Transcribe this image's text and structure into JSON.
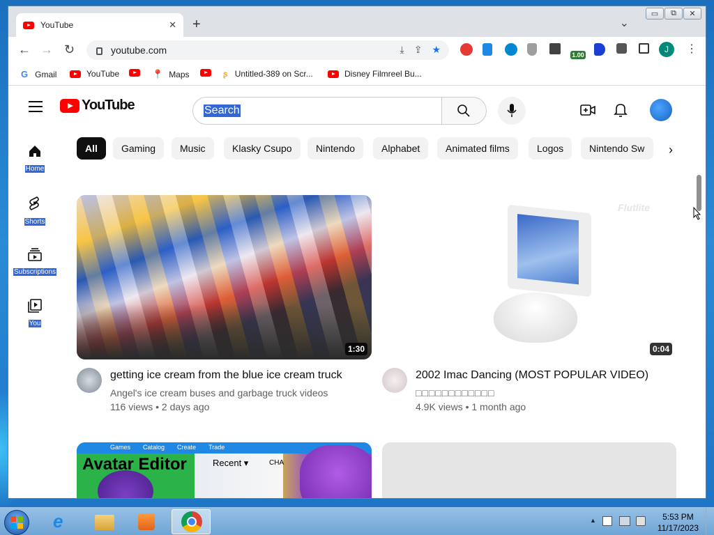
{
  "browser": {
    "tab": {
      "title": "YouTube",
      "close": "✕"
    },
    "new_tab": "+",
    "tab_search": "⌄",
    "window_controls": {
      "minimize": "▭",
      "restore": "⧉",
      "close": "✕"
    },
    "nav": {
      "back": "←",
      "forward": "→",
      "reload": "↻"
    },
    "url": "youtube.com",
    "profile_initial": "J",
    "extension_badge": "1.00",
    "menu": "⋮"
  },
  "bookmarks": [
    {
      "label": "Gmail",
      "icon": "google-icon"
    },
    {
      "label": "YouTube",
      "icon": "youtube-icon"
    },
    {
      "label": "",
      "icon": "youtube-icon"
    },
    {
      "label": "Maps",
      "icon": "maps-pin-icon"
    },
    {
      "label": "",
      "icon": "youtube-icon"
    },
    {
      "label": "Untitled-389 on Scr...",
      "icon": "scratch-icon"
    },
    {
      "label": "Disney Filmreel Bu...",
      "icon": "youtube-icon"
    }
  ],
  "youtube": {
    "logo_text": "YouTube",
    "search_text": "Search",
    "chips": [
      "All",
      "Gaming",
      "Music",
      "Klasky Csupo",
      "Nintendo",
      "Alphabet",
      "Animated films",
      "Logos",
      "Nintendo Sw"
    ],
    "sidebar": [
      {
        "label": "Home",
        "icon": "home-icon"
      },
      {
        "label": "Shorts",
        "icon": "shorts-icon"
      },
      {
        "label": "Subscriptions",
        "icon": "subscriptions-icon"
      },
      {
        "label": "You",
        "icon": "library-icon"
      }
    ],
    "videos": [
      {
        "title": "getting ice cream from the blue ice cream truck",
        "channel": "Angel's ice cream buses and garbage truck videos",
        "meta": "116 views • 2 days ago",
        "duration": "1:30"
      },
      {
        "title": "2002 Imac Dancing (MOST POPULAR VIDEO)",
        "channel": "□□□□□□□□□□□□",
        "meta": "4.9K views • 1 month ago",
        "duration": "0:04",
        "watermark": "Flutlite"
      }
    ],
    "third_thumb_text": {
      "editor": "Avatar Editor",
      "recent": "Recent ▾",
      "menu": [
        "Games",
        "Catalog",
        "Create",
        "Trade"
      ],
      "side": "CHA"
    }
  },
  "taskbar": {
    "time": "5:53 PM",
    "date": "11/17/2023",
    "tray_arrow": "▲"
  },
  "colors": {
    "youtube_red": "#ff0000",
    "selection": "#3367d6",
    "chrome_blue": "#1a73e8"
  }
}
